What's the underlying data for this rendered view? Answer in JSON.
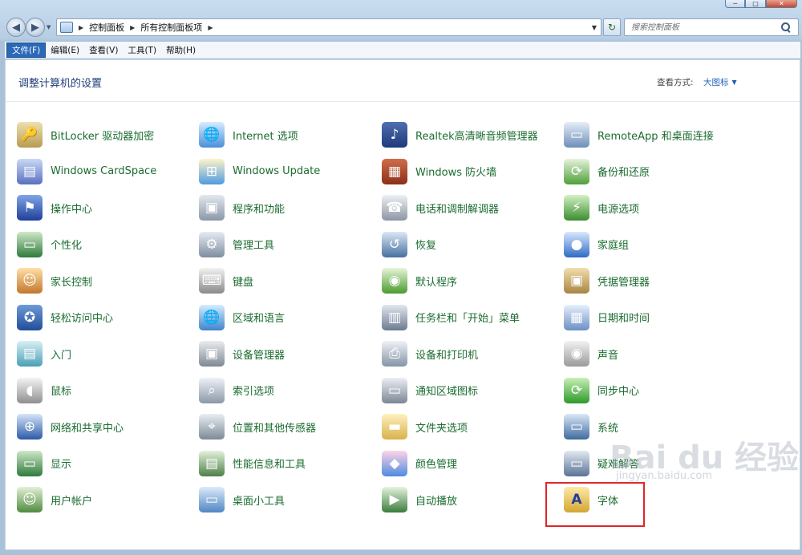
{
  "window": {
    "minimize_glyph": "─",
    "maximize_glyph": "□",
    "close_glyph": "✕"
  },
  "address_bar": {
    "crumbs": [
      "控制面板",
      "所有控制面板项"
    ]
  },
  "search": {
    "placeholder": "搜索控制面板"
  },
  "menu": {
    "items": [
      "文件(F)",
      "编辑(E)",
      "查看(V)",
      "工具(T)",
      "帮助(H)"
    ],
    "active_index": 0
  },
  "header": {
    "title": "调整计算机的设置",
    "view_label": "查看方式:",
    "view_value": "大图标"
  },
  "items": [
    {
      "label": "BitLocker 驱动器加密",
      "icon": "bitlocker-key-icon"
    },
    {
      "label": "Internet 选项",
      "icon": "internet-globe-icon"
    },
    {
      "label": "Realtek高清晰音频管理器",
      "icon": "realtek-audio-icon"
    },
    {
      "label": "RemoteApp 和桌面连接",
      "icon": "remoteapp-monitor-icon"
    },
    {
      "label": "Windows CardSpace",
      "icon": "cardspace-icon"
    },
    {
      "label": "Windows Update",
      "icon": "windows-update-icon"
    },
    {
      "label": "Windows 防火墙",
      "icon": "firewall-brick-icon"
    },
    {
      "label": "备份和还原",
      "icon": "backup-restore-icon"
    },
    {
      "label": "操作中心",
      "icon": "action-center-flag-icon"
    },
    {
      "label": "程序和功能",
      "icon": "programs-features-icon"
    },
    {
      "label": "电话和调制解调器",
      "icon": "phone-modem-icon"
    },
    {
      "label": "电源选项",
      "icon": "power-battery-icon"
    },
    {
      "label": "个性化",
      "icon": "personalization-monitor-icon"
    },
    {
      "label": "管理工具",
      "icon": "admin-tools-gear-icon"
    },
    {
      "label": "恢复",
      "icon": "recovery-monitor-icon"
    },
    {
      "label": "家庭组",
      "icon": "homegroup-icon"
    },
    {
      "label": "家长控制",
      "icon": "parental-controls-icon"
    },
    {
      "label": "键盘",
      "icon": "keyboard-icon"
    },
    {
      "label": "默认程序",
      "icon": "default-programs-icon"
    },
    {
      "label": "凭据管理器",
      "icon": "credential-safe-icon"
    },
    {
      "label": "轻松访问中心",
      "icon": "ease-of-access-icon"
    },
    {
      "label": "区域和语言",
      "icon": "region-language-globe-icon"
    },
    {
      "label": "任务栏和「开始」菜单",
      "icon": "taskbar-start-menu-icon"
    },
    {
      "label": "日期和时间",
      "icon": "date-time-calendar-icon"
    },
    {
      "label": "入门",
      "icon": "getting-started-icon"
    },
    {
      "label": "设备管理器",
      "icon": "device-manager-icon"
    },
    {
      "label": "设备和打印机",
      "icon": "devices-printers-icon"
    },
    {
      "label": "声音",
      "icon": "sound-speaker-icon"
    },
    {
      "label": "鼠标",
      "icon": "mouse-icon"
    },
    {
      "label": "索引选项",
      "icon": "indexing-magnifier-icon"
    },
    {
      "label": "通知区域图标",
      "icon": "notification-area-icon"
    },
    {
      "label": "同步中心",
      "icon": "sync-center-icon"
    },
    {
      "label": "网络和共享中心",
      "icon": "network-sharing-icon"
    },
    {
      "label": "位置和其他传感器",
      "icon": "location-sensors-icon"
    },
    {
      "label": "文件夹选项",
      "icon": "folder-options-icon"
    },
    {
      "label": "系统",
      "icon": "system-computer-icon"
    },
    {
      "label": "显示",
      "icon": "display-monitor-icon"
    },
    {
      "label": "性能信息和工具",
      "icon": "performance-tools-icon"
    },
    {
      "label": "颜色管理",
      "icon": "color-management-icon"
    },
    {
      "label": "疑难解答",
      "icon": "troubleshooting-icon"
    },
    {
      "label": "用户帐户",
      "icon": "user-accounts-icon"
    },
    {
      "label": "桌面小工具",
      "icon": "desktop-gadgets-icon"
    },
    {
      "label": "自动播放",
      "icon": "autoplay-icon"
    },
    {
      "label": "字体",
      "icon": "fonts-folder-icon"
    }
  ],
  "highlighted_item": "字体",
  "watermark": {
    "text": "Bai du 经验",
    "sub": "jingyan.baidu.com"
  }
}
